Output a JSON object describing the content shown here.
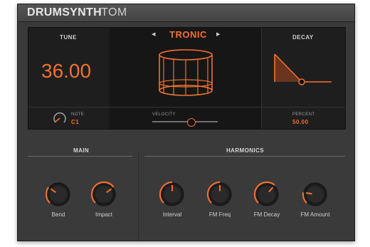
{
  "header": {
    "title": "DRUMSYNTH",
    "subtitle": "TOM"
  },
  "display": {
    "tune": {
      "label": "TUNE",
      "value": "36.00",
      "note_label": "NOTE",
      "note_value": "C1"
    },
    "engine": {
      "name": "TRONIC",
      "prev_icon": "left-arrow",
      "next_icon": "right-arrow",
      "velocity_label": "VELOCITY",
      "velocity_level": 0.6
    },
    "decay": {
      "label": "DECAY",
      "percent_label": "PERCENT",
      "percent_value": "50.00"
    }
  },
  "main": {
    "title": "MAIN",
    "knobs": [
      {
        "label": "Bend",
        "level": 0.3
      },
      {
        "label": "Impact",
        "level": 0.7
      }
    ]
  },
  "harmonics": {
    "title": "HARMONICS",
    "knobs": [
      {
        "label": "Interval",
        "level": 0.5
      },
      {
        "label": "FM Freq",
        "level": 0.5
      },
      {
        "label": "FM Decay",
        "level": 0.65
      },
      {
        "label": "FM Amount",
        "level": 0.2
      }
    ]
  },
  "colors": {
    "accent": "#f07030",
    "panel": "#3a3a3a",
    "display": "#1e1e1e"
  }
}
